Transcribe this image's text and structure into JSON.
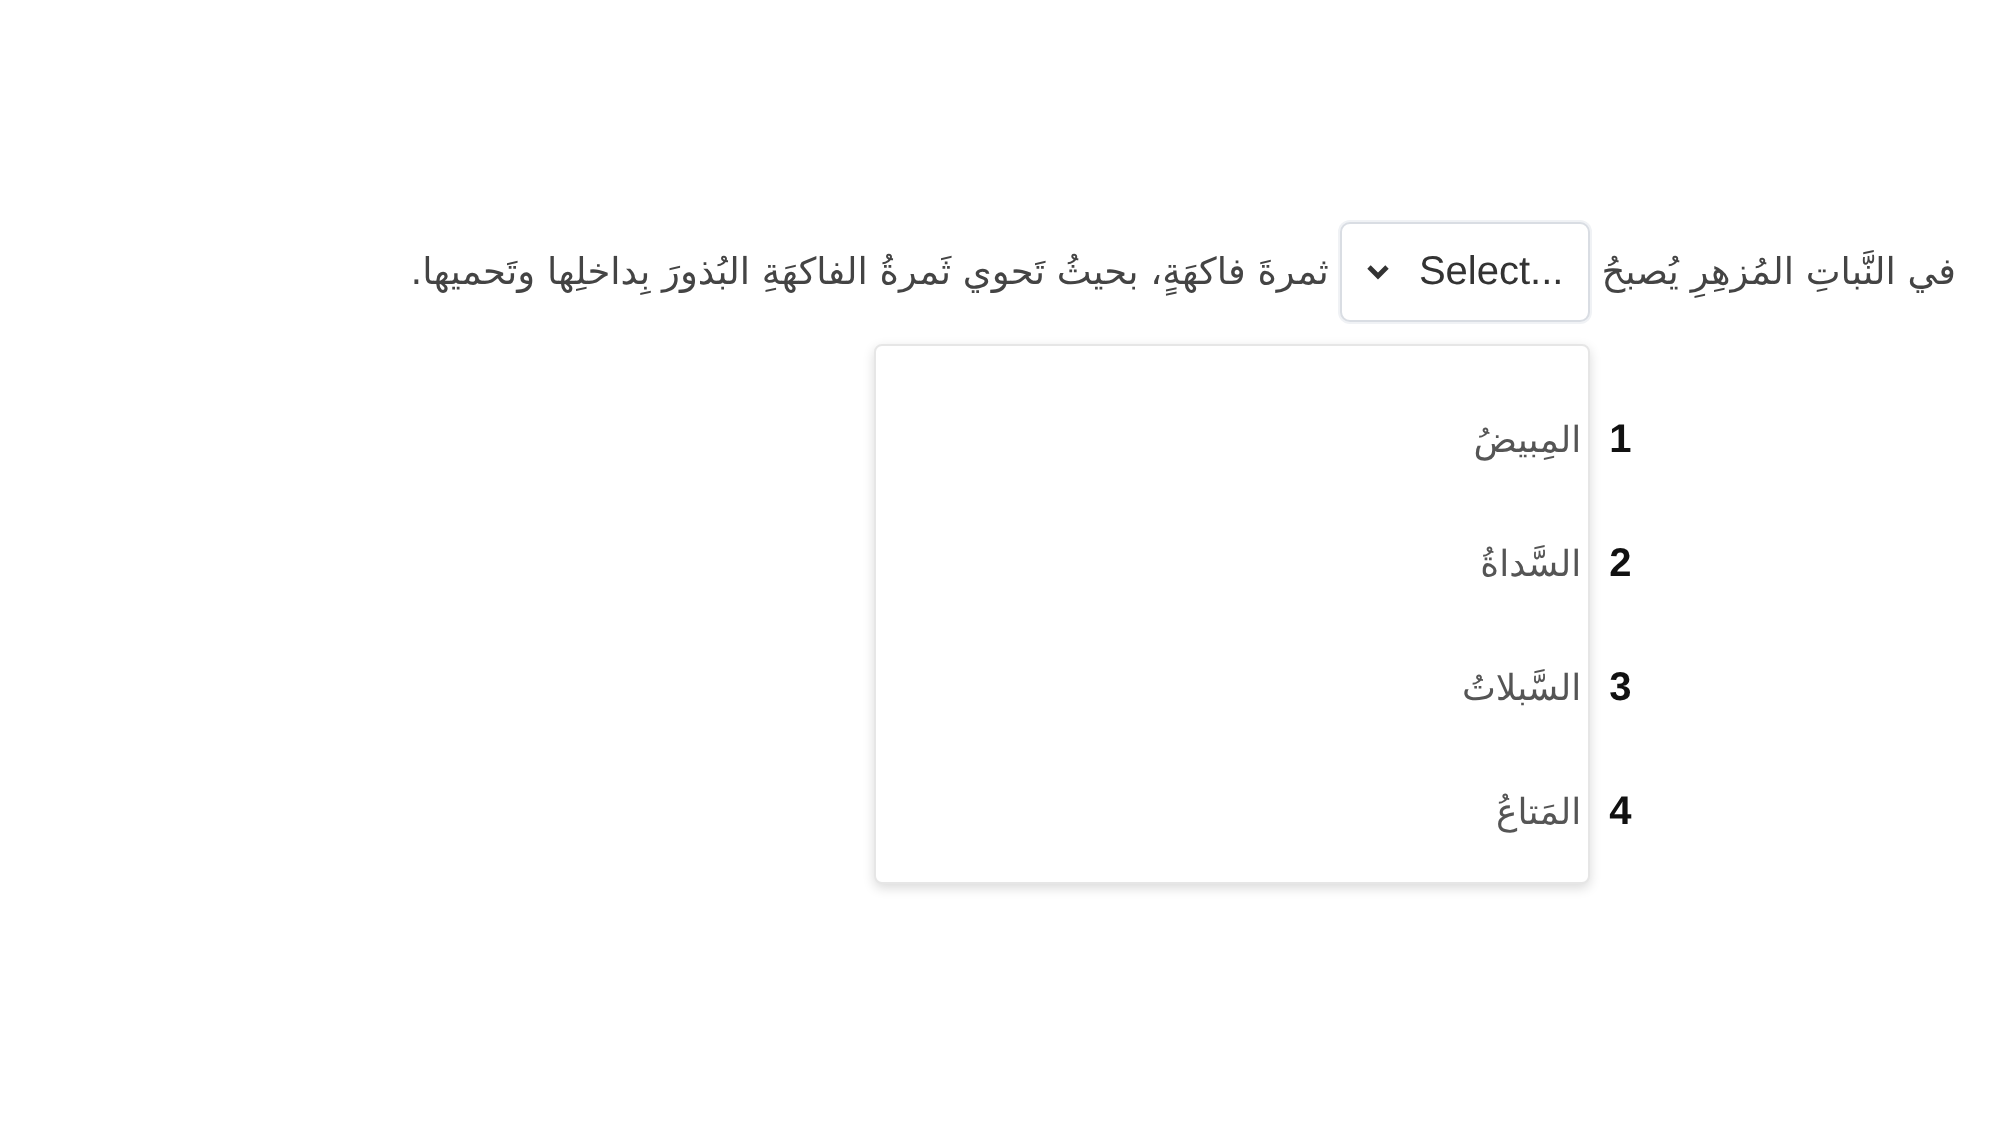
{
  "question": {
    "text_before": "في النَّباتِ المُزهِرِ يُصبحُ",
    "select": {
      "placeholder": "Select...",
      "expanded": true,
      "options": [
        {
          "number": "1",
          "label": "المِبيضُ",
          "selected": false
        },
        {
          "number": "2",
          "label": "السَّداةُ",
          "selected": false
        },
        {
          "number": "3",
          "label": "السَّبلاتُ",
          "selected": false
        },
        {
          "number": "4",
          "label": "المَتاعُ",
          "selected": false
        }
      ]
    },
    "text_after": "ثمرةَ فاكهَةٍ، بحيثُ تَحوي ثَمرةُ الفاكهَةِ البُذورَ بِداخلِها وتَحميها."
  }
}
